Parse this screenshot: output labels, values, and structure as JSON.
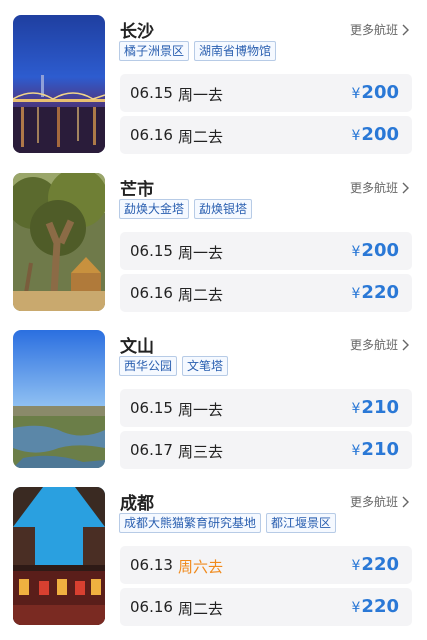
{
  "more_label": "更多航班",
  "currency": "¥",
  "colors": {
    "price": "#2a78d6",
    "weekend": "#f08a1c",
    "tag_text": "#2a5fb0"
  },
  "cards": [
    {
      "city": "长沙",
      "photo": "night-bridge-image",
      "tags": [
        "橘子洲景区",
        "湖南省博物馆"
      ],
      "flights": [
        {
          "date": "06.15",
          "day": "周一去",
          "price": "200",
          "weekend": false
        },
        {
          "date": "06.16",
          "day": "周二去",
          "price": "200",
          "weekend": false
        }
      ]
    },
    {
      "city": "芒市",
      "photo": "banyan-tree-image",
      "tags": [
        "勐焕大金塔",
        "勐焕银塔"
      ],
      "flights": [
        {
          "date": "06.15",
          "day": "周一去",
          "price": "200",
          "weekend": false
        },
        {
          "date": "06.16",
          "day": "周二去",
          "price": "220",
          "weekend": false
        }
      ]
    },
    {
      "city": "文山",
      "photo": "lake-landscape-image",
      "tags": [
        "西华公园",
        "文笔塔"
      ],
      "flights": [
        {
          "date": "06.15",
          "day": "周一去",
          "price": "210",
          "weekend": false
        },
        {
          "date": "06.17",
          "day": "周三去",
          "price": "210",
          "weekend": false
        }
      ]
    },
    {
      "city": "成都",
      "photo": "ancient-street-image",
      "tags": [
        "成都大熊猫繁育研究基地",
        "都江堰景区"
      ],
      "flights": [
        {
          "date": "06.13",
          "day": "周六去",
          "price": "220",
          "weekend": true
        },
        {
          "date": "06.16",
          "day": "周二去",
          "price": "220",
          "weekend": false
        }
      ]
    }
  ]
}
